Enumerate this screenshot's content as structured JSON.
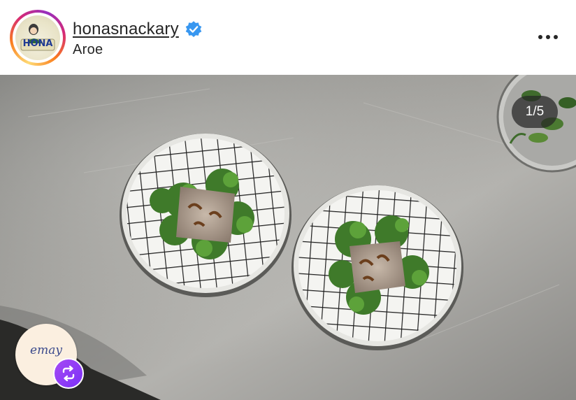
{
  "post_header": {
    "username": "honasnackary",
    "verified": true,
    "location": "Aroe",
    "avatar_text": "HONA",
    "more_icon": "more-horizontal-icon"
  },
  "media": {
    "counter": "1/5",
    "emay_text": "emay",
    "repost_icon": "repost-icon"
  },
  "colors": {
    "text": "#262626",
    "verified_blue": "#3897f0",
    "counter_bg": "#262626",
    "repost_purple": "#8a3cf5"
  }
}
